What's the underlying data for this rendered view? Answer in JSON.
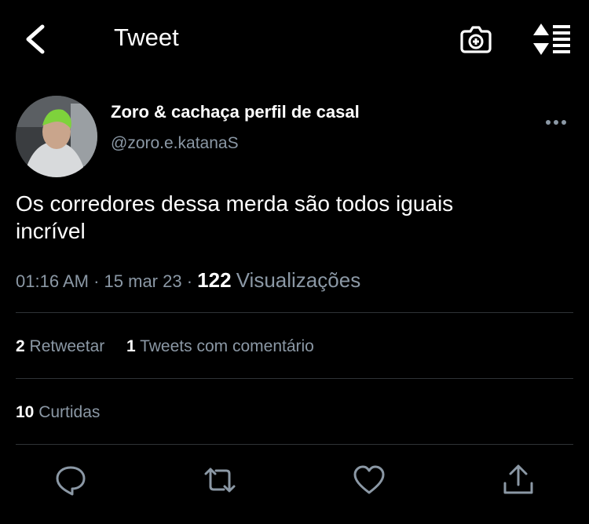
{
  "header": {
    "title": "Tweet"
  },
  "tweet": {
    "author_name": "Zoro & cachaça perfil de casal",
    "author_handle": "@zoro.e.katanaS",
    "text_line1": "Os corredores dessa merda são todos iguais",
    "text_line2": "incrível",
    "time": "01:16 AM",
    "sep1": "·",
    "date": "15 mar 23",
    "sep2": "·",
    "views_count": "122",
    "views_label": "Visualizações"
  },
  "stats": {
    "retweets_count": "2",
    "retweets_label": "Retweetar",
    "quotes_count": "1",
    "quotes_label": "Tweets com comentário",
    "likes_count": "10",
    "likes_label": "Curtidas"
  },
  "icons": {
    "back": "back-arrow-icon",
    "camera": "camera-add-icon",
    "sort": "sort-icon",
    "more": "more-icon",
    "reply": "reply-icon",
    "retweet": "retweet-icon",
    "like": "heart-icon",
    "share": "share-icon"
  },
  "colors": {
    "background": "#000000",
    "text": "#ffffff",
    "secondary": "#8b98a5"
  }
}
